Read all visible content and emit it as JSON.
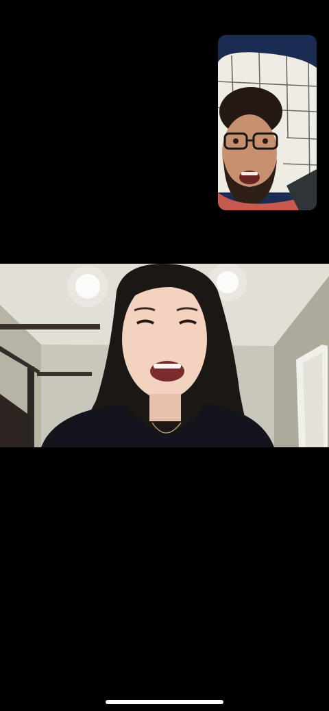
{
  "call": {
    "self_view": {
      "description_icon": "person-glasses-icon"
    },
    "remote_view": {
      "description_icon": "person-long-hair-icon"
    }
  },
  "colors": {
    "background": "#000000",
    "home_indicator": "#ffffff",
    "pip_pillow": "#f2efe6",
    "pip_shirt": "#c65a50",
    "remote_wall": "#c9c6bb",
    "remote_hair": "#1a1714",
    "remote_shirt": "#14151c"
  }
}
